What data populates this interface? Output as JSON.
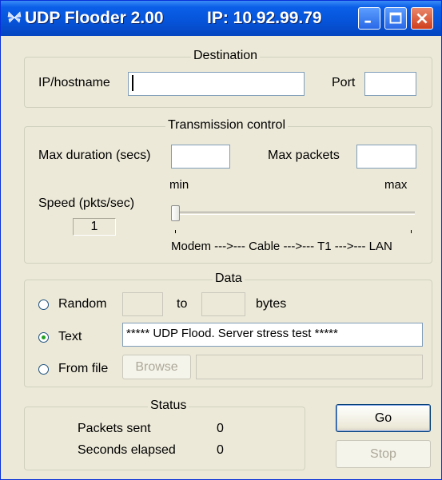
{
  "window": {
    "title": "UDP Flooder 2.00",
    "ip_label": "IP: 10.92.99.79",
    "icon": "app-butterfly-icon",
    "controls": [
      "minimize-icon",
      "maximize-icon",
      "close-icon"
    ]
  },
  "destination": {
    "legend": "Destination",
    "ip_label": "IP/hostname",
    "ip_value": "",
    "port_label": "Port",
    "port_value": ""
  },
  "transmission": {
    "legend": "Transmission control",
    "max_duration_label": "Max duration (secs)",
    "max_duration_value": "",
    "max_packets_label": "Max packets",
    "max_packets_value": "",
    "speed_label": "Speed (pkts/sec)",
    "speed_value": "1",
    "slider_min_label": "min",
    "slider_max_label": "max",
    "slider_scale_label": "Modem --->--- Cable --->--- T1 --->--- LAN",
    "slider_level": 0
  },
  "data": {
    "legend": "Data",
    "random_label": "Random",
    "random_from": "",
    "to_label": "to",
    "random_to": "",
    "bytes_label": "bytes",
    "text_label": "Text",
    "text_value": "***** UDP Flood. Server stress test *****",
    "from_file_label": "From file",
    "browse_label": "Browse",
    "file_value": "",
    "selected": "Text"
  },
  "status": {
    "legend": "Status",
    "packets_sent_label": "Packets sent",
    "packets_sent_value": "0",
    "seconds_elapsed_label": "Seconds elapsed",
    "seconds_elapsed_value": "0"
  },
  "actions": {
    "go_label": "Go",
    "stop_label": "Stop"
  },
  "colors": {
    "titlebar": "#0653d8",
    "face": "#ece9d8",
    "close_button": "#cf3e1c"
  }
}
